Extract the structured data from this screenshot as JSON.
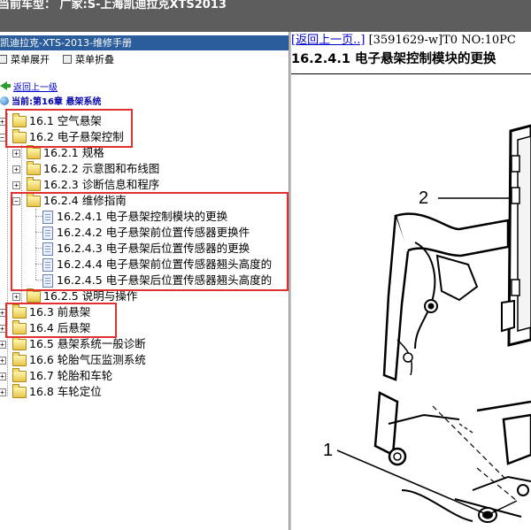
{
  "header": {
    "title": "当前车型：  广家:S-上海凯迪拉克XTS2013"
  },
  "manual": {
    "title": "凯迪拉克-XTS-2013-维修手册"
  },
  "menu": {
    "expand_label": "菜单展开",
    "collapse_label": "菜单折叠"
  },
  "nav": {
    "back_label": "返回上一级",
    "current_label": "当前:第16章 悬架系统"
  },
  "tree": [
    {
      "key": "n1",
      "label": "16.1 空气悬架",
      "type": "folder",
      "level": 0,
      "state": "collapsed"
    },
    {
      "key": "n2",
      "label": "16.2 电子悬架控制",
      "type": "folder",
      "level": 0,
      "state": "expanded"
    },
    {
      "key": "n3",
      "label": "16.2.1 规格",
      "type": "folder",
      "level": 1,
      "state": "collapsed"
    },
    {
      "key": "n4",
      "label": "16.2.2 示意图和布线图",
      "type": "folder",
      "level": 1,
      "state": "collapsed"
    },
    {
      "key": "n5",
      "label": "16.2.3 诊断信息和程序",
      "type": "folder",
      "level": 1,
      "state": "collapsed"
    },
    {
      "key": "n6",
      "label": "16.2.4 维修指南",
      "type": "folder",
      "level": 1,
      "state": "expanded"
    },
    {
      "key": "n7",
      "label": "16.2.4.1 电子悬架控制模块的更换",
      "type": "doc",
      "level": 2
    },
    {
      "key": "n8",
      "label": "16.2.4.2 电子悬架前位置传感器更换件",
      "type": "doc",
      "level": 2
    },
    {
      "key": "n9",
      "label": "16.2.4.3 电子悬架后位置传感器的更换",
      "type": "doc",
      "level": 2
    },
    {
      "key": "n10",
      "label": "16.2.4.4 电子悬架前位置传感器翘头高度的",
      "type": "doc",
      "level": 2
    },
    {
      "key": "n11",
      "label": "16.2.4.5 电子悬架后位置传感器翘头高度的",
      "type": "doc",
      "level": 2
    },
    {
      "key": "n12",
      "label": "16.2.5 说明与操作",
      "type": "folder",
      "level": 1,
      "state": "collapsed"
    },
    {
      "key": "n13",
      "label": "16.3 前悬架",
      "type": "folder",
      "level": 0,
      "state": "collapsed"
    },
    {
      "key": "n14",
      "label": "16.4 后悬架",
      "type": "folder",
      "level": 0,
      "state": "collapsed"
    },
    {
      "key": "n15",
      "label": "16.5 悬架系统一般诊断",
      "type": "folder",
      "level": 0,
      "state": "collapsed"
    },
    {
      "key": "n16",
      "label": "16.6 轮胎气压监测系统",
      "type": "folder",
      "level": 0,
      "state": "collapsed"
    },
    {
      "key": "n17",
      "label": "16.7 轮胎和车轮",
      "type": "folder",
      "level": 0,
      "state": "collapsed"
    },
    {
      "key": "n18",
      "label": "16.8 车轮定位",
      "type": "folder",
      "level": 0,
      "state": "collapsed"
    }
  ],
  "content": {
    "back_link": "[返回上一页..]",
    "doc_id": "[3591629-w]T0 NO:10PC",
    "title": "16.2.4.1 电子悬架控制模块的更换",
    "callouts": [
      "1",
      "2"
    ]
  },
  "colors": {
    "topbar": "#5d5d5d",
    "manual_bar": "#2b5d9d",
    "highlight_box": "#e03030",
    "link": "#0000cc"
  }
}
